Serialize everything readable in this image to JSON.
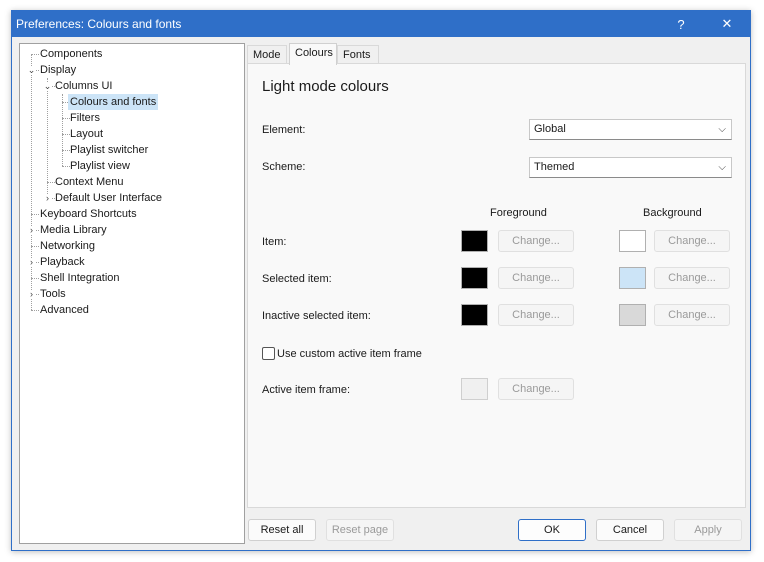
{
  "window": {
    "title": "Preferences: Colours and fonts",
    "help_glyph": "?",
    "close_glyph": "✕"
  },
  "tree": {
    "items": [
      {
        "label": "Components"
      },
      {
        "label": "Display"
      },
      {
        "label": "Columns UI"
      },
      {
        "label": "Colours and fonts",
        "selected": true
      },
      {
        "label": "Filters"
      },
      {
        "label": "Layout"
      },
      {
        "label": "Playlist switcher"
      },
      {
        "label": "Playlist view"
      },
      {
        "label": "Context Menu"
      },
      {
        "label": "Default User Interface"
      },
      {
        "label": "Keyboard Shortcuts"
      },
      {
        "label": "Media Library"
      },
      {
        "label": "Networking"
      },
      {
        "label": "Playback"
      },
      {
        "label": "Shell Integration"
      },
      {
        "label": "Tools"
      },
      {
        "label": "Advanced"
      }
    ]
  },
  "tabs": [
    {
      "label": "Mode"
    },
    {
      "label": "Colours",
      "active": true
    },
    {
      "label": "Fonts"
    }
  ],
  "panel": {
    "title": "Light mode colours",
    "element_label": "Element:",
    "element_value": "Global",
    "scheme_label": "Scheme:",
    "scheme_value": "Themed",
    "foreground_header": "Foreground",
    "background_header": "Background",
    "rows": [
      {
        "label": "Item:",
        "fg_color": "#000000",
        "bg_color": "#ffffff",
        "fg_button": "Change...",
        "bg_button": "Change..."
      },
      {
        "label": "Selected item:",
        "fg_color": "#000000",
        "bg_color": "#cce4f7",
        "fg_button": "Change...",
        "bg_button": "Change..."
      },
      {
        "label": "Inactive selected item:",
        "fg_color": "#000000",
        "bg_color": "#d9d9d9",
        "fg_button": "Change...",
        "bg_button": "Change..."
      }
    ],
    "custom_frame_checkbox_label": "Use custom active item frame",
    "custom_frame_checked": false,
    "active_frame_label": "Active item frame:",
    "active_frame_color": "#f0f0f0",
    "active_frame_button": "Change..."
  },
  "footer": {
    "reset_all": "Reset all",
    "reset_page": "Reset page",
    "ok": "OK",
    "cancel": "Cancel",
    "apply": "Apply"
  },
  "colors": {
    "titlebar": "#2f6fc8",
    "selection": "#cce4f7"
  }
}
